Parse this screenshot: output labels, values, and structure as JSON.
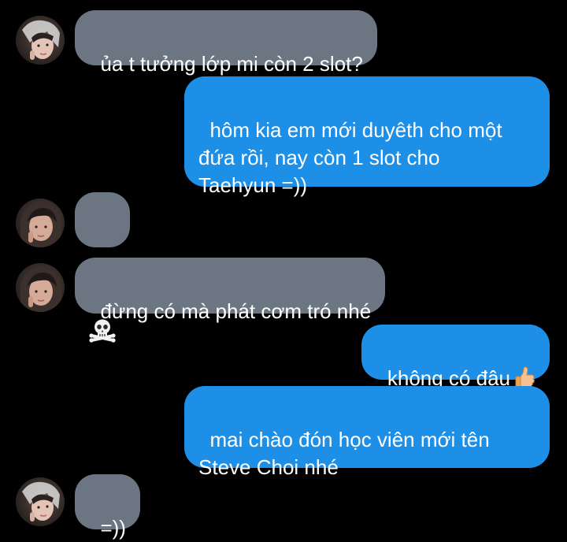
{
  "thread": {
    "messages": [
      {
        "from": "other",
        "text": "ủa t tưởng lớp mi còn 2 slot?"
      },
      {
        "from": "me",
        "text": "hôm kia em mới duyêth cho một\nđứa rồi, nay còn 1 slot cho\nTaehyun =))"
      },
      {
        "from": "other",
        "text": "",
        "emoji": "skull-and-crossbones-icon"
      },
      {
        "from": "other",
        "text": "đừng có mà phát cơm tró nhé"
      },
      {
        "from": "me",
        "text": "không có đâu",
        "emoji": "thumbs-up-icon"
      },
      {
        "from": "me",
        "text": "mai chào đón học viên mới tên\nSteve Choi nhé"
      },
      {
        "from": "other",
        "text": "=))"
      }
    ]
  },
  "colors": {
    "background": "#000000",
    "incoming_bubble": "#6c7683",
    "outgoing_bubble": "#1e8fe7",
    "text": "#ffffff"
  }
}
